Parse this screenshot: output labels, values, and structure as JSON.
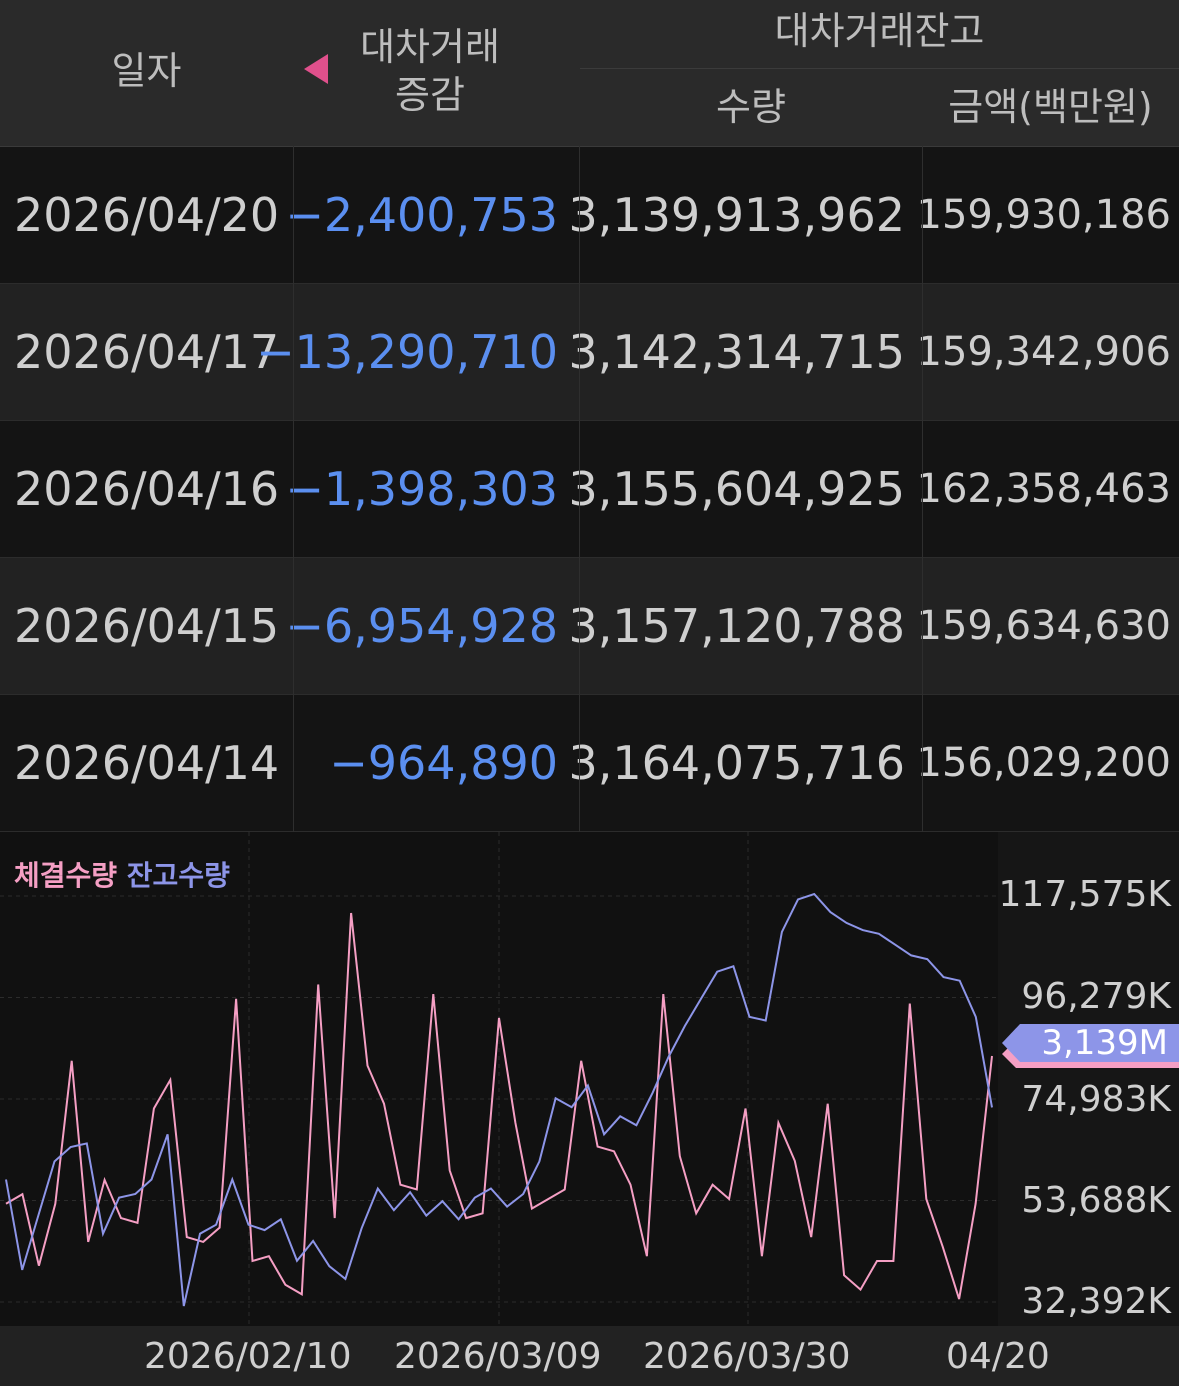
{
  "header": {
    "date_col": "일자",
    "change_col_line1": "대차거래",
    "change_col_line2": "증감",
    "balance_group": "대차거래잔고",
    "qty_col": "수량",
    "amount_col": "금액(백만원)"
  },
  "colors": {
    "negative": "#5b8ff0",
    "trade_line": "#f59fc4",
    "balance_line": "#8d95e8",
    "marker_triangle": "#e0508c"
  },
  "rows": [
    {
      "date": "2026/04/20",
      "change": "−2,400,753",
      "qty": "3,139,913,962",
      "amount": "159,930,186"
    },
    {
      "date": "2026/04/17",
      "change": "−13,290,710",
      "qty": "3,142,314,715",
      "amount": "159,342,906"
    },
    {
      "date": "2026/04/16",
      "change": "−1,398,303",
      "qty": "3,155,604,925",
      "amount": "162,358,463"
    },
    {
      "date": "2026/04/15",
      "change": "−6,954,928",
      "qty": "3,157,120,788",
      "amount": "159,634,630"
    },
    {
      "date": "2026/04/14",
      "change": "−964,890",
      "qty": "3,164,075,716",
      "amount": "156,029,200"
    }
  ],
  "chart": {
    "legend_trade": "체결수량",
    "legend_balance": "잔고수량",
    "y_labels": [
      "117,575K",
      "96,279K",
      "74,983K",
      "53,688K",
      "32,392K"
    ],
    "x_labels": [
      "2026/02/10",
      "2026/03/09",
      "2026/03/30",
      "04/20"
    ],
    "current_marker": "3,139M"
  },
  "chart_data": {
    "type": "line",
    "y_ticks": [
      117575,
      96279,
      74983,
      53688,
      32392
    ],
    "x_ticks": [
      "2026/02/10",
      "2026/03/09",
      "2026/03/30",
      "04/20"
    ],
    "series": [
      {
        "name": "체결수량",
        "values": [
          53000,
          55000,
          40000,
          53000,
          83000,
          45000,
          58000,
          50000,
          49000,
          73000,
          79000,
          46000,
          45000,
          48000,
          96000,
          41000,
          42000,
          36000,
          34000,
          99000,
          50000,
          114000,
          82000,
          74000,
          57000,
          56000,
          97000,
          60000,
          50000,
          51000,
          92000,
          70000,
          52000,
          54000,
          56000,
          83000,
          65000,
          64000,
          57000,
          42000,
          97000,
          63000,
          51000,
          57000,
          54000,
          73000,
          42000,
          70000,
          62000,
          46000,
          74000,
          38000,
          35000,
          41000,
          41000,
          95000,
          54000,
          44000,
          33000,
          53000,
          84000
        ]
      },
      {
        "name": "잔고수량",
        "values": [
          3100000000,
          3050000000,
          3080000000,
          3110000000,
          3118000000,
          3120000000,
          3070000000,
          3090000000,
          3092000000,
          3100000000,
          3125000000,
          3030000000,
          3070000000,
          3075000000,
          3100000000,
          3075000000,
          3072000000,
          3078000000,
          3055000000,
          3066000000,
          3052000000,
          3045000000,
          3073000000,
          3095000000,
          3083000000,
          3093000000,
          3080000000,
          3088000000,
          3078000000,
          3090000000,
          3095000000,
          3085000000,
          3092000000,
          3110000000,
          3145000000,
          3140000000,
          3152000000,
          3125000000,
          3135000000,
          3130000000,
          3148000000,
          3168000000,
          3185000000,
          3200000000,
          3215000000,
          3218000000,
          3190000000,
          3188000000,
          3237000000,
          3255000000,
          3258000000,
          3248000000,
          3242000000,
          3238000000,
          3236000000,
          3230000000,
          3224000000,
          3222000000,
          3212000000,
          3210000000,
          3190000000,
          3139913962
        ]
      }
    ]
  }
}
